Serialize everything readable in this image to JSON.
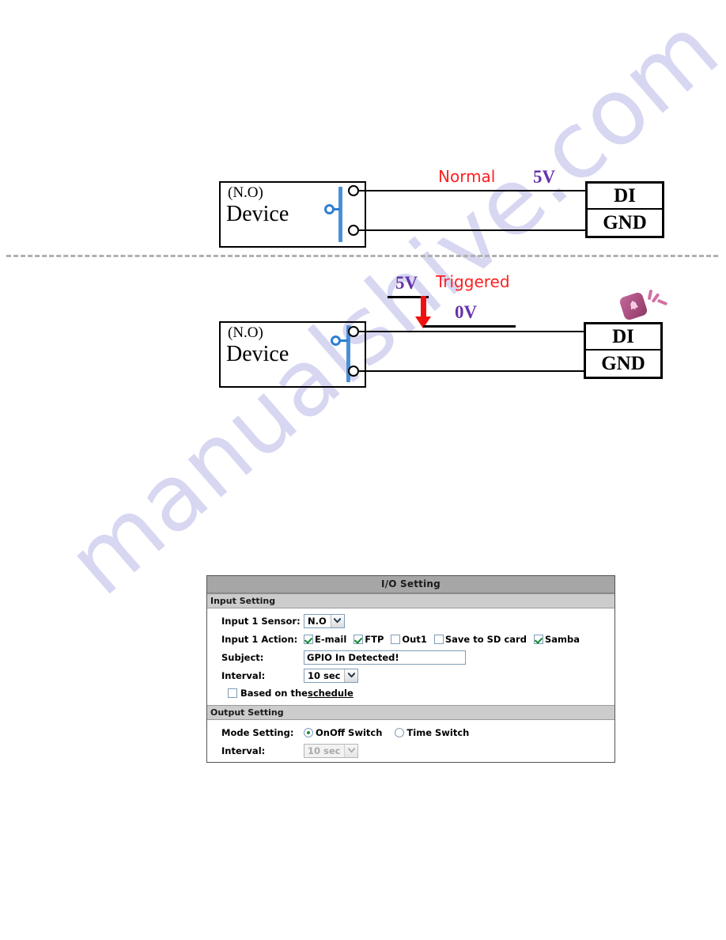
{
  "watermark": {
    "text": "manualshive.com"
  },
  "diagrams": [
    {
      "state_label": "Normal",
      "voltage_label": "5V",
      "device_type": "(N.O)",
      "device_name": "Device",
      "terminal_top": "DI",
      "terminal_bottom": "GND"
    },
    {
      "state_label": "Triggered",
      "voltage_high": "5V",
      "voltage_low": "0V",
      "device_type": "(N.O)",
      "device_name": "Device",
      "terminal_top": "DI",
      "terminal_bottom": "GND",
      "alarm_icon": "bell-alarm-icon"
    }
  ],
  "io_panel": {
    "title": "I/O Setting",
    "input_section": {
      "heading": "Input Setting",
      "sensor_label": "Input 1 Sensor:",
      "sensor_value": "N.O",
      "action_label": "Input 1 Action:",
      "actions": [
        {
          "label": "E-mail",
          "checked": true
        },
        {
          "label": "FTP",
          "checked": true
        },
        {
          "label": "Out1",
          "checked": false
        },
        {
          "label": "Save to SD card",
          "checked": false
        },
        {
          "label": "Samba",
          "checked": true
        }
      ],
      "subject_label": "Subject:",
      "subject_value": "GPIO In Detected!",
      "interval_label": "Interval:",
      "interval_value": "10 sec",
      "schedule_checked": false,
      "schedule_text": "Based on the ",
      "schedule_link": "schedule"
    },
    "output_section": {
      "heading": "Output Setting",
      "mode_label": "Mode Setting:",
      "modes": [
        {
          "label": "OnOff Switch",
          "selected": true
        },
        {
          "label": "Time Switch",
          "selected": false
        }
      ],
      "interval_label": "Interval:",
      "interval_value": "10 sec",
      "interval_disabled": true
    }
  },
  "colors": {
    "state_red": "#ff2020",
    "voltage_purple": "#6633aa",
    "switch_blue": "#4a90d9",
    "arrow_red": "#f01010",
    "panel_title_bg": "#a6a6a6",
    "section_bg": "#cccccc",
    "check_green": "#0a8a27",
    "watermark": "#c9c9ee"
  }
}
